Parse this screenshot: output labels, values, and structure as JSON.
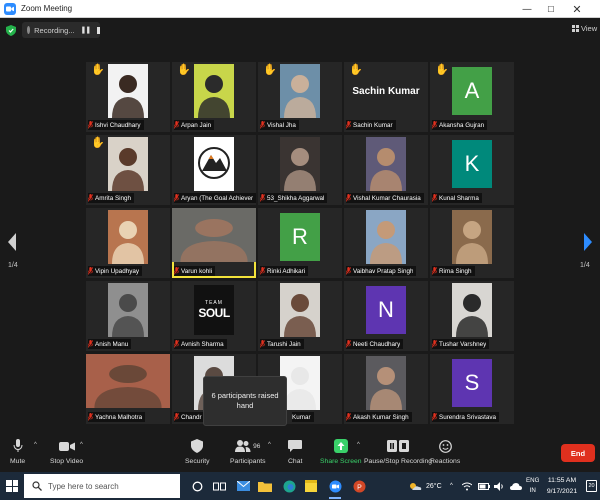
{
  "window": {
    "title": "Zoom Meeting"
  },
  "topbar": {
    "recording_label": "Recording...",
    "view_label": "View"
  },
  "pagination": {
    "left": "1/4",
    "right": "1/4"
  },
  "participants": [
    {
      "name": "Ishvi Chaudhary",
      "hand": true,
      "kind": "photo",
      "bg": "#f2f2f2",
      "fg": "#3a2a22"
    },
    {
      "name": "Arpan Jain",
      "hand": true,
      "kind": "photo",
      "bg": "#c8d64a",
      "fg": "#2b2b2b"
    },
    {
      "name": "Vishal Jha",
      "hand": true,
      "kind": "photo",
      "bg": "#6d8fa8",
      "fg": "#c9b09a"
    },
    {
      "name": "Sachin Kumar",
      "hand": true,
      "kind": "name",
      "bigname": "Sachin Kumar"
    },
    {
      "name": "Akansha Gujran",
      "hand": true,
      "kind": "initial",
      "letter": "A",
      "color": "#43a047"
    },
    {
      "name": "Amrita Singh",
      "hand": true,
      "kind": "photo",
      "bg": "#d9d2c8",
      "fg": "#5a3a2a"
    },
    {
      "name": "Aryan (The Goal Achievers)",
      "hand": false,
      "kind": "logo",
      "bg": "#ffffff"
    },
    {
      "name": "53_Shikha Aggarwal",
      "hand": false,
      "kind": "photo",
      "bg": "#3a3432",
      "fg": "#a58d7e"
    },
    {
      "name": "Vishal Kumar Chaurasia",
      "hand": false,
      "kind": "photo",
      "bg": "#5f5a78",
      "fg": "#b58c6e"
    },
    {
      "name": "Kunal Sharma",
      "hand": false,
      "kind": "initial",
      "letter": "K",
      "color": "#00897b"
    },
    {
      "name": "Vipin Upadhyay",
      "hand": false,
      "kind": "photo",
      "bg": "#b8754f",
      "fg": "#e9d2b3"
    },
    {
      "name": "Varun kohli",
      "hand": false,
      "kind": "photo",
      "bg": "#6a6a66",
      "fg": "#9a7460",
      "speaking": true
    },
    {
      "name": "Rinki Adhikari",
      "hand": false,
      "kind": "initial",
      "letter": "R",
      "color": "#43a047"
    },
    {
      "name": "Vaibhav Pratap Singh",
      "hand": false,
      "kind": "photo",
      "bg": "#8aa6c4",
      "fg": "#c49a78"
    },
    {
      "name": "Rima Singh",
      "hand": false,
      "kind": "photo",
      "bg": "#8a6a4c",
      "fg": "#c6a582"
    },
    {
      "name": "Anish Manu",
      "hand": false,
      "kind": "photo",
      "bg": "#8f8f8f",
      "fg": "#4a4a4a"
    },
    {
      "name": "Avnish Sharma",
      "hand": false,
      "kind": "soul",
      "bg": "#111111",
      "word": "SOUL",
      "small": "TEAM"
    },
    {
      "name": "Tarushi Jain",
      "hand": false,
      "kind": "photo",
      "bg": "#d6d2cc",
      "fg": "#6a4a3a"
    },
    {
      "name": "Neeti Chaudhary",
      "hand": false,
      "kind": "initial",
      "letter": "N",
      "color": "#5e35b1"
    },
    {
      "name": "Tushar Varshney",
      "hand": false,
      "kind": "photo",
      "bg": "#d8d6d2",
      "fg": "#2a2a2a"
    },
    {
      "name": "Yachna Malhotra",
      "hand": false,
      "kind": "photo",
      "bg": "#a8604a",
      "fg": "#6a4838"
    },
    {
      "name": "Chandr",
      "hand": false,
      "kind": "photo",
      "bg": "#dcdcdc",
      "fg": "#5a4a42"
    },
    {
      "name": "",
      "hand": false,
      "kind": "blank"
    },
    {
      "name": "Akash Kumar Singh",
      "hand": false,
      "kind": "photo",
      "bg": "#5b5a5e",
      "fg": "#b59078"
    },
    {
      "name": "Surendra Srivastava",
      "hand": false,
      "kind": "initial",
      "letter": "S",
      "color": "#5e35b1"
    }
  ],
  "tile_extra": {
    "kumar_caption": "Kumar"
  },
  "tooltip": {
    "text": "6 participants raised hand"
  },
  "toolbar": {
    "mute": "Mute",
    "stop_video": "Stop Video",
    "security": "Security",
    "participants": "Participants",
    "participants_count": "96",
    "chat": "Chat",
    "share": "Share Screen",
    "record": "Pause/Stop Recording",
    "reactions": "Reactions",
    "end": "End"
  },
  "taskbar": {
    "search_placeholder": "Type here to search",
    "temperature": "26°C",
    "lang_top": "ENG",
    "lang_bottom": "IN",
    "time": "11:55 AM",
    "date": "9/17/2021",
    "notifications": "20"
  },
  "colors": {
    "accent_blue": "#2d8cff",
    "share_green": "#3ad16a",
    "end_red": "#e0301e",
    "raised_hand": "#f5c518",
    "mic_muted": "#e0301e"
  }
}
